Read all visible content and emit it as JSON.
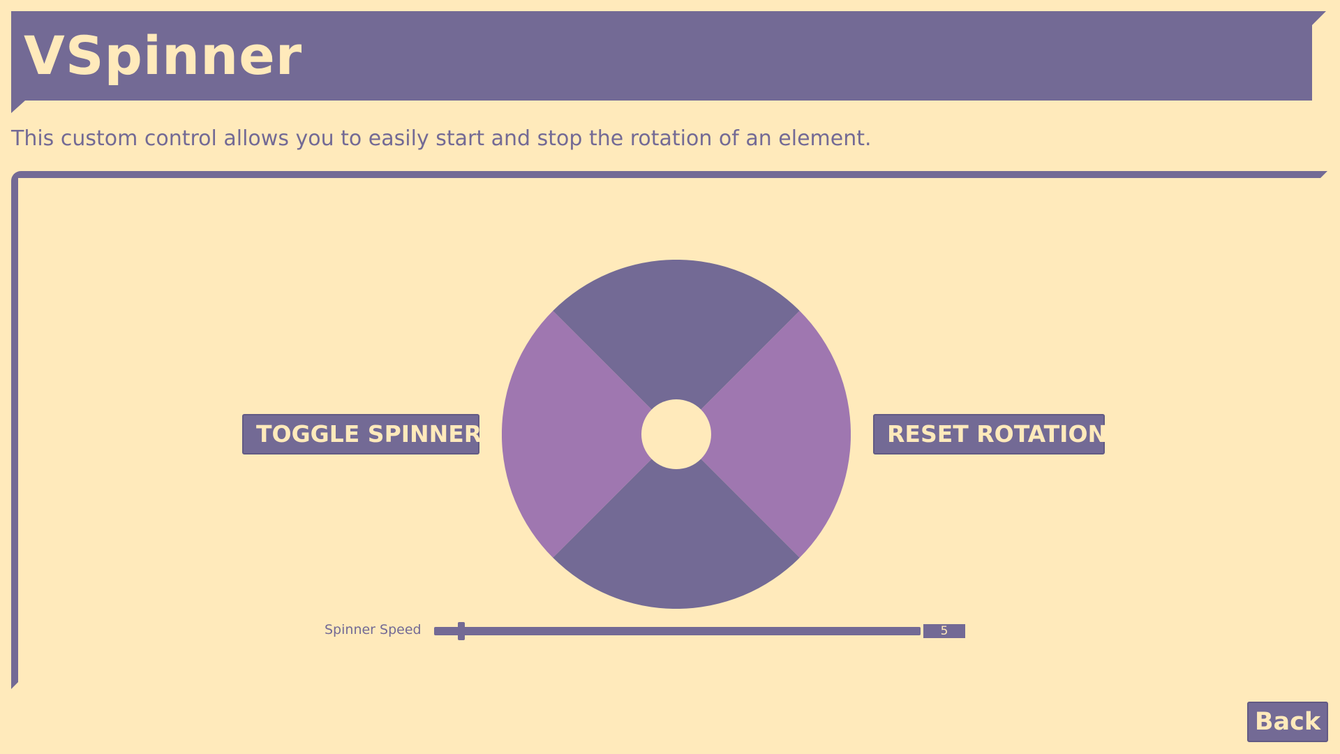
{
  "header": {
    "title": "VSpinner"
  },
  "description": "This custom control allows you to easily start and stop the rotation of an element.",
  "controls": {
    "toggle_label": "TOGGLE SPINNER",
    "reset_label": "RESET ROTATION"
  },
  "speed": {
    "label": "Spinner Speed",
    "value": "5",
    "numeric_value": 5,
    "slider_fraction": 0.05
  },
  "back_label": "Back",
  "spinner": {
    "icon": "spinner-wheel-icon",
    "quadrants": [
      {
        "name": "top",
        "color": "#736a95"
      },
      {
        "name": "right",
        "color": "#9f77b0"
      },
      {
        "name": "bottom",
        "color": "#736a95"
      },
      {
        "name": "left",
        "color": "#9f77b0"
      }
    ],
    "hub_color": "#ffeabb"
  },
  "colors": {
    "background": "#ffeabb",
    "primary": "#736a95",
    "accent": "#9f77b0",
    "text_on_primary": "#ffeabb"
  }
}
